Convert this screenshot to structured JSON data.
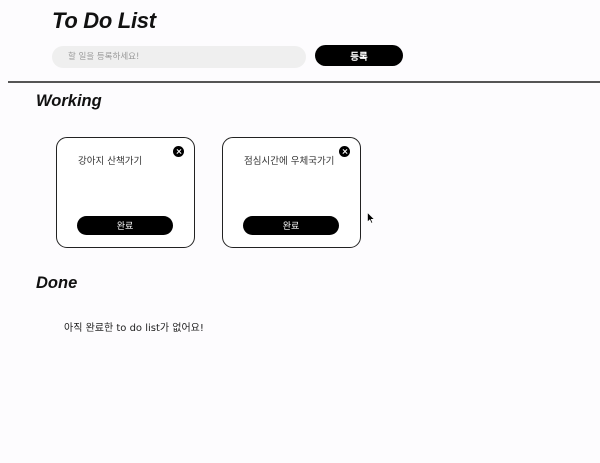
{
  "header": {
    "title": "To Do List",
    "input_value": "",
    "input_placeholder": "할 일을 등록하세요!",
    "add_label": "등록"
  },
  "working": {
    "title": "Working",
    "items": [
      {
        "text": "강아지 산책가기",
        "complete_label": "완료"
      },
      {
        "text": "점심시간에 우체국가기",
        "complete_label": "완료"
      }
    ]
  },
  "done": {
    "title": "Done",
    "empty_message": "아직 완료한 to do list가 없어요!"
  },
  "icons": {
    "delete": "close-circle-icon",
    "cursor": "mouse-pointer-icon"
  },
  "colors": {
    "primary": "#000000",
    "input_bg": "#efefef",
    "background": "#fdfcfe"
  }
}
